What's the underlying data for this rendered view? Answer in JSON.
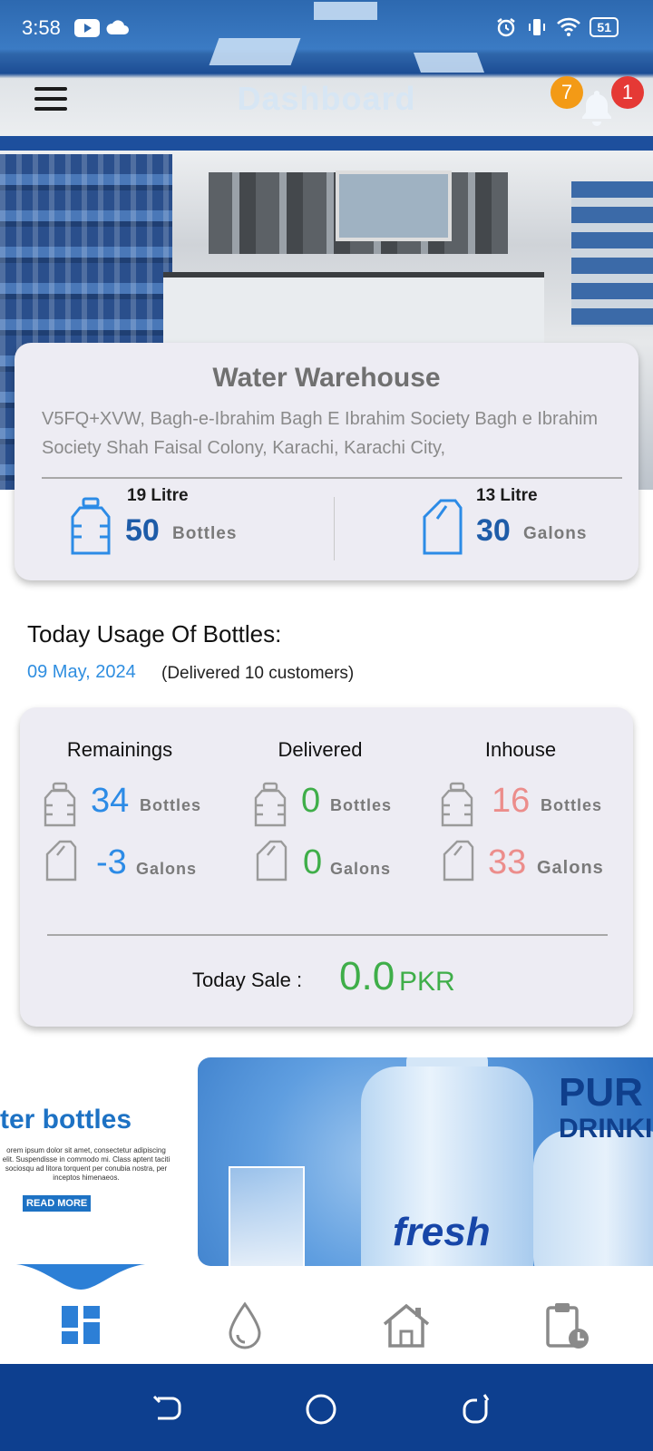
{
  "status_bar": {
    "time": "3:58",
    "battery": "51"
  },
  "app_bar": {
    "title": "Dashboard",
    "badge_orange": "7",
    "badge_red": "1"
  },
  "warehouse": {
    "name": "Water Warehouse",
    "address": "V5FQ+XVW, Bagh-e-Ibrahim Bagh E Ibrahim Society Bagh e Ibrahim Society Shah Faisal Colony, Karachi, Karachi City,",
    "left": {
      "label": "19 Litre",
      "value": "50",
      "unit": "Bottles"
    },
    "right": {
      "label": "13 Litre",
      "value": "30",
      "unit": "Galons"
    }
  },
  "usage": {
    "title": "Today Usage Of Bottles:",
    "date": "09 May, 2024",
    "delivered_text": "(Delivered 10 customers)",
    "columns": [
      {
        "header": "Remainings",
        "bottles": "34",
        "galons": "-3"
      },
      {
        "header": "Delivered",
        "bottles": "0",
        "galons": "0"
      },
      {
        "header": "Inhouse",
        "bottles": "16",
        "galons": "33"
      }
    ],
    "bottles_unit": "Bottles",
    "galons_unit": "Galons",
    "sale_label": "Today Sale :",
    "sale_value": "0.0",
    "sale_currency": "PKR"
  },
  "banners": {
    "left_title": "ter bottles",
    "left_text": "orem ipsum dolor sit amet, consectetur adipiscing elit. Suspendisse in commodo mi. Class aptent taciti sociosqu ad litora torquent per conubia nostra, per inceptos himenaeos.",
    "left_button": "READ MORE",
    "right_word1": "PUR",
    "right_word2": "DRINKI",
    "right_brand": "fresh"
  },
  "bottom_nav": {
    "items": [
      "dashboard-icon",
      "water-drop-icon",
      "home-icon",
      "clipboard-clock-icon"
    ],
    "active_color": "#2c7fd6",
    "inactive_color": "#8a8a8a"
  },
  "colors": {
    "accent_blue": "#2c8be6",
    "dark_blue": "#1e5ca8",
    "green": "#3fae49",
    "pink": "#ec8d8b",
    "nav_bar": "#0d3f8f"
  }
}
